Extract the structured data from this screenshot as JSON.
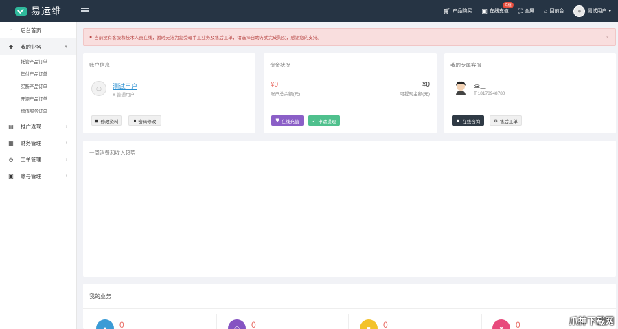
{
  "header": {
    "logo_text": "易运维",
    "menu_toggle_icon": "hamburger-icon",
    "items": [
      {
        "label": "产品购买",
        "icon": "cart-icon"
      },
      {
        "label": "在线充值",
        "icon": "wallet-icon",
        "badge": "充值"
      },
      {
        "label": "全屏",
        "icon": "fullscreen-icon"
      },
      {
        "label": "回前台",
        "icon": "home-icon"
      }
    ],
    "user_label": "测试用户",
    "user_caret": "▾"
  },
  "sidebar": {
    "items": [
      {
        "label": "后台首页",
        "icon": "home-icon"
      },
      {
        "label": "我的业务",
        "icon": "puzzle-icon",
        "arrow": "▾"
      },
      {
        "label": "推广返现",
        "icon": "briefcase-icon",
        "arrow": "›"
      },
      {
        "label": "财务管理",
        "icon": "finance-icon",
        "arrow": "›"
      },
      {
        "label": "工单管理",
        "icon": "clock-icon",
        "arrow": "›"
      },
      {
        "label": "账号管理",
        "icon": "user-card-icon",
        "arrow": "›"
      }
    ],
    "subitems": [
      "托管产品订单",
      "年付产品订单",
      "买断产品订单",
      "开源产品订单",
      "增值服务订单"
    ]
  },
  "alert": {
    "text": "当前没有客服和技术人员在线，暂时无法为您受理手工业务及售后工单，请选择自助方式完成购买，感谢您的支持。",
    "close": "×"
  },
  "account": {
    "title": "账户信息",
    "username": "测试用户",
    "level": "普通用户",
    "btn_profile": "修改资料",
    "btn_password": "密码修改"
  },
  "funds": {
    "title": "资金状况",
    "balance": "¥0",
    "balance_label": "账户总余额(元)",
    "withdrawable": "¥0",
    "withdrawable_label": "可提现金额(元)",
    "btn_recharge": "在线充值",
    "btn_withdraw": "申请提现"
  },
  "service": {
    "title": "我的专属客服",
    "name": "李工",
    "phone": "T 18178948780",
    "btn_consult": "在线咨询",
    "btn_ticket": "售后工单"
  },
  "trend": {
    "title": "一周消费和收入趋势"
  },
  "business": {
    "title": "我的业务",
    "stats": [
      {
        "value": "0",
        "color": "#3b9bd6"
      },
      {
        "value": "0",
        "color": "#8553c2"
      },
      {
        "value": "0",
        "color": "#f3c22b"
      },
      {
        "value": "0",
        "color": "#e84a7c"
      }
    ]
  },
  "watermark": "爪神下载网"
}
